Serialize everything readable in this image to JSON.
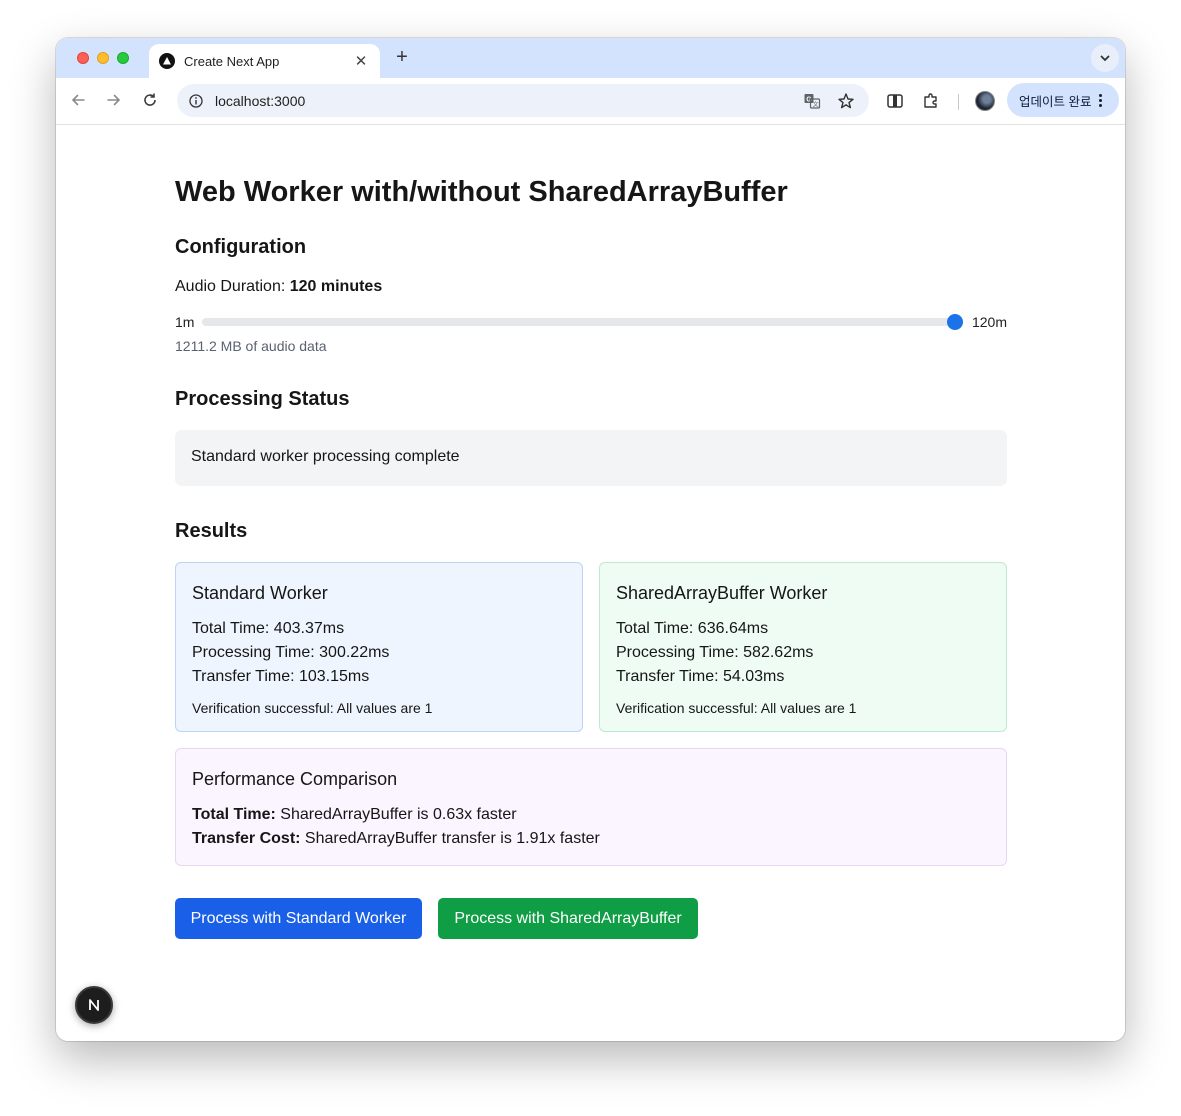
{
  "browser": {
    "tab_title": "Create Next App",
    "url": "localhost:3000",
    "update_button_label": "업데이트 완료"
  },
  "page": {
    "title": "Web Worker with/without SharedArrayBuffer",
    "configuration": {
      "heading": "Configuration",
      "duration_label": "Audio Duration: ",
      "duration_value": "120 minutes",
      "slider_min_label": "1m",
      "slider_max_label": "120m",
      "slider_min": 1,
      "slider_max": 120,
      "slider_value": 120,
      "data_size": "1211.2 MB of audio data"
    },
    "status": {
      "heading": "Processing Status",
      "message": "Standard worker processing complete"
    },
    "results": {
      "heading": "Results",
      "standard": {
        "title": "Standard Worker",
        "total": "Total Time: 403.37ms",
        "processing": "Processing Time: 300.22ms",
        "transfer": "Transfer Time: 103.15ms",
        "verification": "Verification successful: All values are 1"
      },
      "shared": {
        "title": "SharedArrayBuffer Worker",
        "total": "Total Time: 636.64ms",
        "processing": "Processing Time: 582.62ms",
        "transfer": "Transfer Time: 54.03ms",
        "verification": "Verification successful: All values are 1"
      },
      "comparison": {
        "title": "Performance Comparison",
        "total_label": "Total Time:",
        "total_text": " SharedArrayBuffer is 0.63x faster",
        "transfer_label": "Transfer Cost:",
        "transfer_text": " SharedArrayBuffer transfer is 1.91x faster"
      }
    },
    "buttons": {
      "standard": "Process with Standard Worker",
      "shared": "Process with SharedArrayBuffer"
    },
    "next_badge": "N"
  },
  "colors": {
    "accent_blue": "#1a5fe8",
    "accent_green": "#0f9d45",
    "slider_thumb": "#1a73e8"
  }
}
